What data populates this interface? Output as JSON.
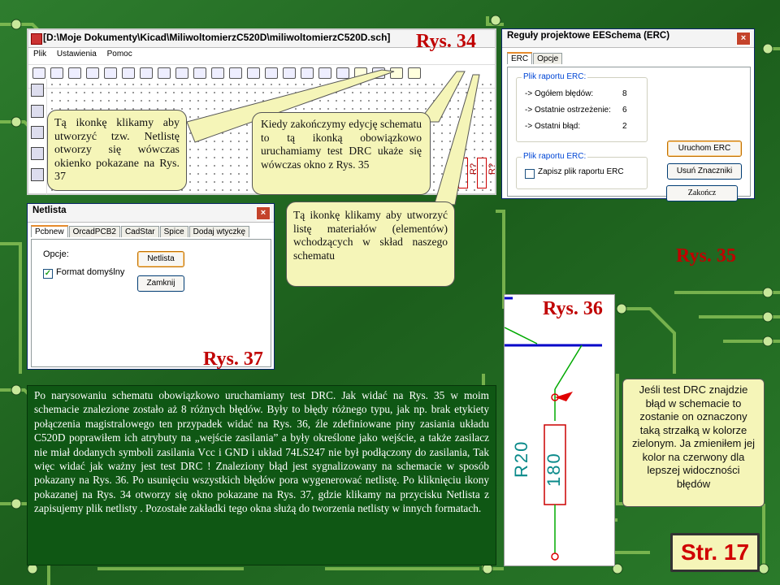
{
  "kicad_window": {
    "title": "[D:\\Moje Dokumenty\\Kicad\\MiliwoltomierzC520D\\miliwoltomierzC520D.sch]",
    "menu": [
      "Plik",
      "Ustawienia",
      "Pomoc"
    ],
    "components": [
      "R?",
      "R?",
      "R?"
    ]
  },
  "erc_dialog": {
    "title": "Reguły projektowe EESchema (ERC)",
    "tabs": [
      "ERC",
      "Opcje"
    ],
    "report_group": "Plik raportu ERC:",
    "total_label": "-> Ogółem błędów:",
    "total_value": "8",
    "warnings_label": "-> Ostatnie ostrzeżenie:",
    "warnings_value": "6",
    "last_error_label": "-> Ostatni błąd:",
    "last_error_value": "2",
    "btn_run": "Uruchom ERC",
    "btn_clear": "Usuń Znaczniki",
    "file_group": "Plik raportu ERC:",
    "save_checkbox": "Zapisz plik raportu ERC",
    "btn_close": "Zakończ"
  },
  "netlist_dialog": {
    "title": "Netlista",
    "tabs": [
      "Pcbnew",
      "OrcadPCB2",
      "CadStar",
      "Spice",
      "Dodaj wtyczkę"
    ],
    "options_label": "Opcje:",
    "default_format": "Format domyślny",
    "btn_netlist": "Netlista",
    "btn_close": "Zamknij"
  },
  "schematic": {
    "ref": "R20",
    "value": "180"
  },
  "labels": {
    "rys34": "Rys. 34",
    "rys35": "Rys. 35",
    "rys36": "Rys. 36",
    "rys37": "Rys. 37",
    "page": "Str. 17"
  },
  "callouts": {
    "netlist": "Tą ikonkę klikamy aby utworzyć tzw. Netlistę otworzy się wówczas okienko pokazane na Rys. 37",
    "drc": "Kiedy zakończymy edycję schematu to tą ikonką obowiązkowo uruchamiamy test DRC ukaże się wówczas okno z Rys. 35",
    "bom": "Tą ikonkę klikamy aby utworzyć listę materiałów (elementów) wchodzących w skład naszego schematu",
    "drc_hint": "Jeśli test DRC znajdzie błąd w schemacie to zostanie on oznaczony taką strzałką w kolorze zielonym. Ja zmieniłem jej kolor na czerwony dla lepszej widoczności błędów"
  },
  "main_text": "Po narysowaniu schematu obowiązkowo uruchamiamy test DRC. Jak widać na Rys. 35 w moim schemacie znalezione zostało aż 8 różnych błędów. Były to błędy różnego typu, jak np. brak etykiety połączenia magistralowego ten przypadek widać na Rys. 36, źle zdefiniowane piny zasiania układu C520D poprawiłem ich atrybuty na „wejście zasilania” a były określone jako wejście, a także zasilacz nie miał dodanych symboli zasilania Vcc i GND i układ 74LS247 nie był podłączony do zasilania, Tak więc widać jak ważny jest test DRC ! Znaleziony błąd jest sygnalizowany na schemacie w sposób pokazany na Rys. 36. Po usunięciu wszystkich błędów pora wygenerować netlistę. Po kliknięciu ikony pokazanej na Rys. 34 otworzy się okno pokazane na Rys. 37, gdzie klikamy na przycisku Netlista z zapisujemy plik netlisty . Pozostałe zakładki tego okna służą do tworzenia netlisty w innych formatach.",
  "colors": {
    "pcb_green": "#1f6b1f",
    "trace": "#7fb74a",
    "callout_bg": "#f5f5b8",
    "label_red": "#c00000",
    "text_box": "#0f5714"
  }
}
